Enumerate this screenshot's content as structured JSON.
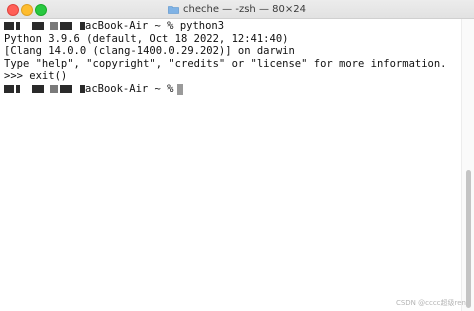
{
  "window": {
    "title": "cheche — -zsh — 80×24",
    "folder_icon": "folder-icon"
  },
  "terminal": {
    "prompt1": "acBook-Air ~ % python3",
    "line2": "Python 3.9.6 (default, Oct 18 2022, 12:41:40)",
    "line3": "[Clang 14.0.0 (clang-1400.0.29.202)] on darwin",
    "line4": "Type \"help\", \"copyright\", \"credits\" or \"license\" for more information.",
    "line5": ">>> exit()",
    "prompt2": "acBook-Air ~ %"
  },
  "watermark": "CSDN @cccc超级ren"
}
